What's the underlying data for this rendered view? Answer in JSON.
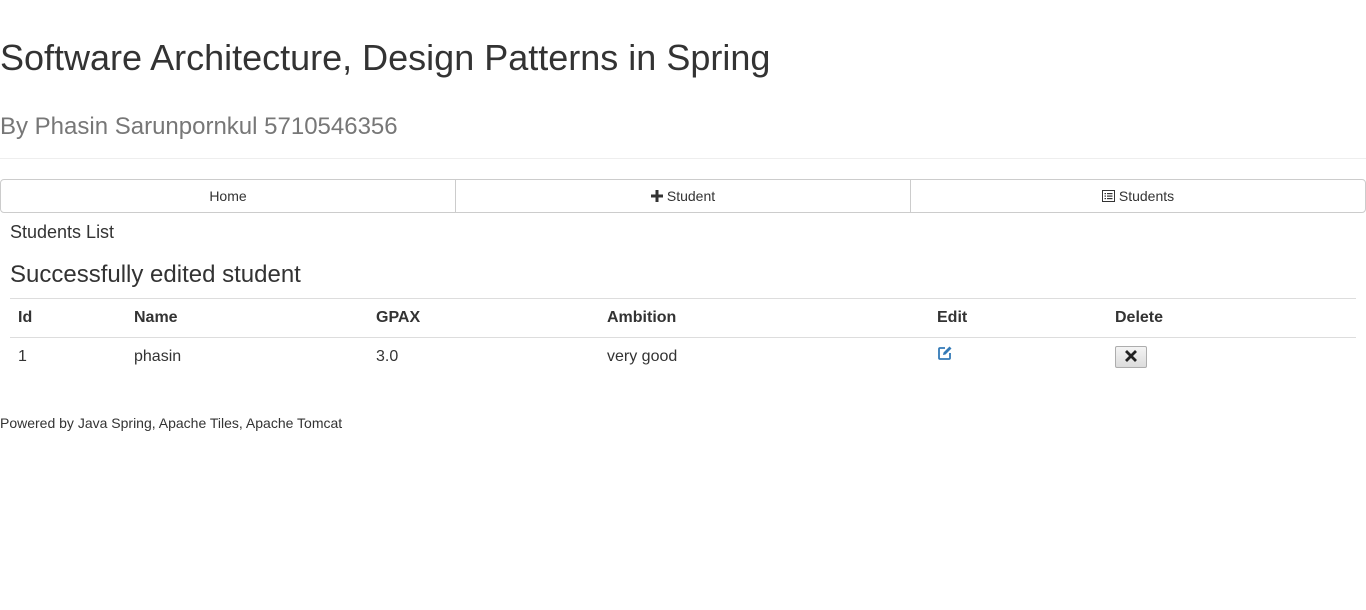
{
  "header": {
    "title": "Software Architecture, Design Patterns in Spring",
    "subtitle": "By Phasin Sarunpornkul 5710546356"
  },
  "nav": {
    "home_label": "Home",
    "add_student_label": "Student",
    "add_student_icon": "plus-icon",
    "students_label": "Students",
    "students_icon": "list-alt-icon"
  },
  "main": {
    "section_label": "Students List",
    "status_message": "Successfully edited student",
    "table": {
      "columns": [
        "Id",
        "Name",
        "GPAX",
        "Ambition",
        "Edit",
        "Delete"
      ],
      "rows": [
        {
          "id": "1",
          "name": "phasin",
          "gpax": "3.0",
          "ambition": "very good",
          "edit_icon": "edit-icon",
          "delete_icon": "remove-icon"
        }
      ]
    }
  },
  "footer": {
    "text": "Powered by Java Spring, Apache Tiles, Apache Tomcat"
  },
  "colors": {
    "link_blue": "#337ab7",
    "muted_text": "#777777",
    "border": "#cccccc"
  }
}
